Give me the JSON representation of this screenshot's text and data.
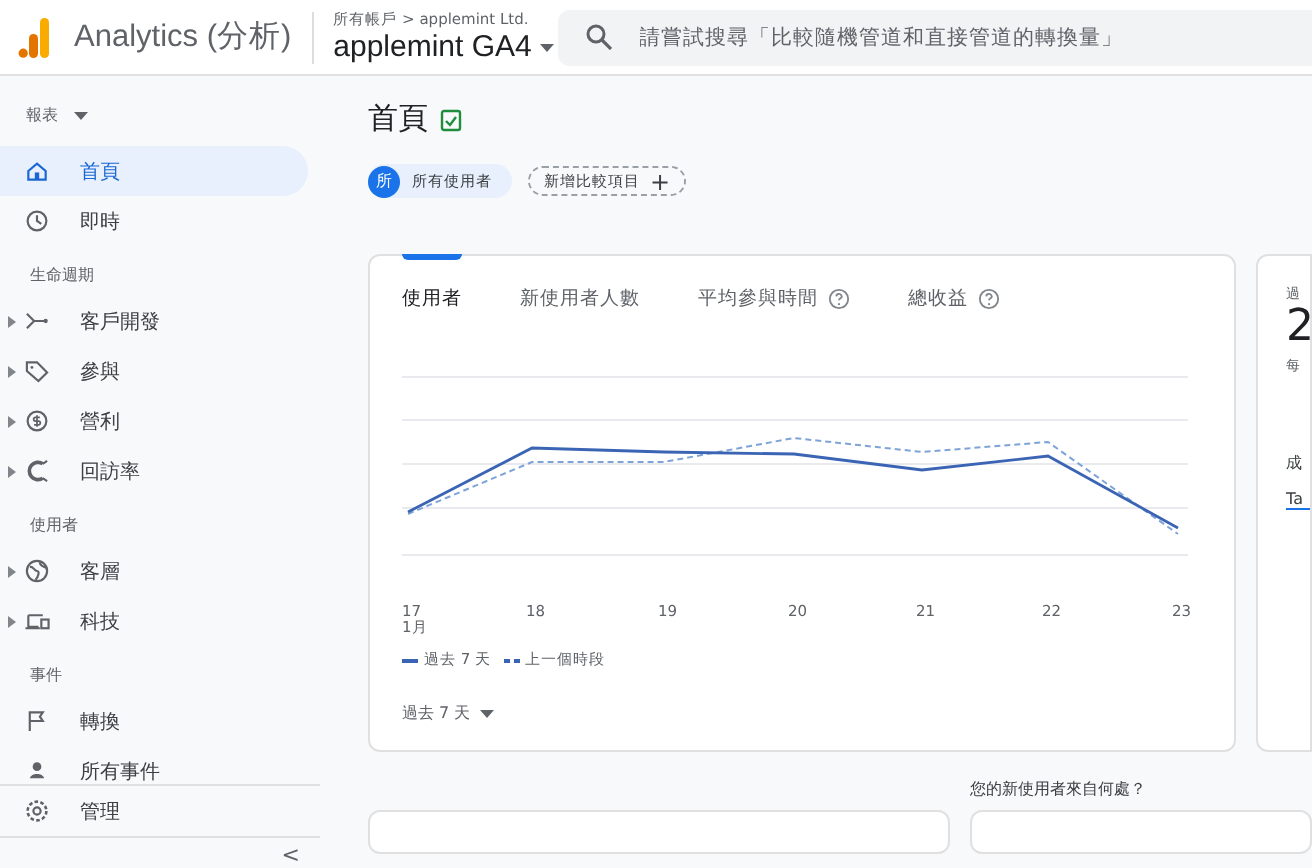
{
  "header": {
    "product": "Analytics (分析)",
    "breadcrumb": "所有帳戶 > applemint Ltd.",
    "property": "applemint GA4",
    "search": {
      "placeholder": "請嘗試搜尋「比較隨機管道和直接管道的轉換量」"
    }
  },
  "sidebar": {
    "title": "報表",
    "items": [
      {
        "kind": "item",
        "label": "首頁",
        "selected": true,
        "expandable": false
      },
      {
        "kind": "item",
        "label": "即時",
        "selected": false,
        "expandable": false
      },
      {
        "kind": "section",
        "label": "生命週期"
      },
      {
        "kind": "item",
        "label": "客戶開發",
        "selected": false,
        "expandable": true
      },
      {
        "kind": "item",
        "label": "參與",
        "selected": false,
        "expandable": true
      },
      {
        "kind": "item",
        "label": "營利",
        "selected": false,
        "expandable": true
      },
      {
        "kind": "item",
        "label": "回訪率",
        "selected": false,
        "expandable": true
      },
      {
        "kind": "section",
        "label": "使用者"
      },
      {
        "kind": "item",
        "label": "客層",
        "selected": false,
        "expandable": true
      },
      {
        "kind": "item",
        "label": "科技",
        "selected": false,
        "expandable": true
      },
      {
        "kind": "section",
        "label": "事件"
      },
      {
        "kind": "item",
        "label": "轉換",
        "selected": false,
        "expandable": false
      },
      {
        "kind": "item",
        "label": "所有事件",
        "selected": false,
        "expandable": false
      }
    ],
    "footer": {
      "label": "管理"
    },
    "collapse": "<"
  },
  "page": {
    "title": "首頁",
    "chips": [
      {
        "kind": "segment",
        "badge": "所",
        "label": "所有使用者"
      },
      {
        "kind": "add",
        "label": "新增比較項目",
        "icon": "+"
      }
    ]
  },
  "overview_card": {
    "tabs": [
      {
        "label": "使用者",
        "help": false,
        "selected": true
      },
      {
        "label": "新使用者人數",
        "help": false,
        "selected": false
      },
      {
        "label": "平均參與時間",
        "help": true,
        "selected": false
      },
      {
        "label": "總收益",
        "help": true,
        "selected": false
      }
    ],
    "x_labels": [
      "17",
      "18",
      "19",
      "20",
      "21",
      "22",
      "23"
    ],
    "x_sublabel": "1月",
    "legend": [
      {
        "kind": "solid",
        "label": "過去 7 天"
      },
      {
        "kind": "dashed",
        "label": "上一個時段"
      }
    ],
    "range": "過去 7 天"
  },
  "side_card": {
    "heading": "過",
    "value": "2",
    "caption": "每",
    "row": "成",
    "tab": "Ta"
  },
  "section_title": "您的新使用者來自何處？"
}
